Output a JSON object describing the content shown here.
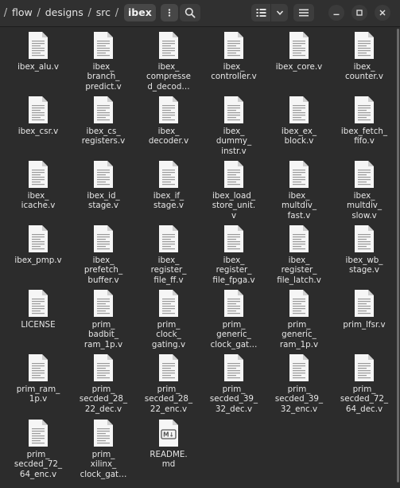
{
  "breadcrumbs": [
    "flow",
    "designs",
    "src",
    "ibex"
  ],
  "path_separator": "/",
  "colors": {
    "window_bg": "#2c2c2c",
    "headerbar_bg": "#303030",
    "text": "#e6e6e6",
    "file_icon": "#f6f6f6",
    "file_lines": "#9a9a9a"
  },
  "icons": {
    "path_menu": "three-dots-vertical-icon",
    "search": "search-icon",
    "view_toggle": "list-view-icon",
    "view_options": "chevron-down-icon",
    "main_menu": "hamburger-menu-icon",
    "minimize": "minimize-icon",
    "maximize": "maximize-icon",
    "close": "close-icon"
  },
  "files": [
    {
      "label": "ibex_alu.v",
      "icon": "text"
    },
    {
      "label": "ibex_\nbranch_\npredict.v",
      "icon": "text"
    },
    {
      "label": "ibex_\ncompresse\nd_decod…",
      "icon": "text"
    },
    {
      "label": "ibex_\ncontroller.v",
      "icon": "text"
    },
    {
      "label": "ibex_core.v",
      "icon": "text"
    },
    {
      "label": "ibex_\ncounter.v",
      "icon": "text"
    },
    {
      "label": "ibex_csr.v",
      "icon": "text"
    },
    {
      "label": "ibex_cs_\nregisters.v",
      "icon": "text"
    },
    {
      "label": "ibex_\ndecoder.v",
      "icon": "text"
    },
    {
      "label": "ibex_\ndummy_\ninstr.v",
      "icon": "text"
    },
    {
      "label": "ibex_ex_\nblock.v",
      "icon": "text"
    },
    {
      "label": "ibex_fetch_\nfifo.v",
      "icon": "text"
    },
    {
      "label": "ibex_\nicache.v",
      "icon": "text"
    },
    {
      "label": "ibex_id_\nstage.v",
      "icon": "text"
    },
    {
      "label": "ibex_if_\nstage.v",
      "icon": "text"
    },
    {
      "label": "ibex_load_\nstore_unit.\nv",
      "icon": "text"
    },
    {
      "label": "ibex_\nmultdiv_\nfast.v",
      "icon": "text"
    },
    {
      "label": "ibex_\nmultdiv_\nslow.v",
      "icon": "text"
    },
    {
      "label": "ibex_pmp.v",
      "icon": "text"
    },
    {
      "label": "ibex_\nprefetch_\nbuffer.v",
      "icon": "text"
    },
    {
      "label": "ibex_\nregister_\nfile_ff.v",
      "icon": "text"
    },
    {
      "label": "ibex_\nregister_\nfile_fpga.v",
      "icon": "text"
    },
    {
      "label": "ibex_\nregister_\nfile_latch.v",
      "icon": "text"
    },
    {
      "label": "ibex_wb_\nstage.v",
      "icon": "text"
    },
    {
      "label": "LICENSE",
      "icon": "text"
    },
    {
      "label": "prim_\nbadbit_\nram_1p.v",
      "icon": "text"
    },
    {
      "label": "prim_\nclock_\ngating.v",
      "icon": "text"
    },
    {
      "label": "prim_\ngeneric_\nclock_gat…",
      "icon": "text"
    },
    {
      "label": "prim_\ngeneric_\nram_1p.v",
      "icon": "text"
    },
    {
      "label": "prim_lfsr.v",
      "icon": "text"
    },
    {
      "label": "prim_ram_\n1p.v",
      "icon": "text"
    },
    {
      "label": "prim_\nsecded_28_\n22_dec.v",
      "icon": "text"
    },
    {
      "label": "prim_\nsecded_28_\n22_enc.v",
      "icon": "text"
    },
    {
      "label": "prim_\nsecded_39_\n32_dec.v",
      "icon": "text"
    },
    {
      "label": "prim_\nsecded_39_\n32_enc.v",
      "icon": "text"
    },
    {
      "label": "prim_\nsecded_72_\n64_dec.v",
      "icon": "text"
    },
    {
      "label": "prim_\nsecded_72_\n64_enc.v",
      "icon": "text"
    },
    {
      "label": "prim_\nxilinx_\nclock_gat…",
      "icon": "text"
    },
    {
      "label": "README.\nmd",
      "icon": "markdown",
      "badge": "M↓"
    }
  ]
}
